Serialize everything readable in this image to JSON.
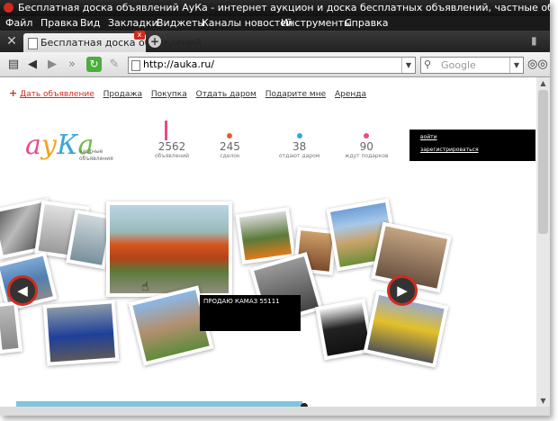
{
  "window": {
    "title": "Бесплатная доска объявлений АуКа - интернет аукцион и доска бесплатных объявлений, частные объявления - бесплат..."
  },
  "menu": [
    "Файл",
    "Правка",
    "Вид",
    "Закладки",
    "Виджеты",
    "Каналы новостей",
    "Инструменты",
    "Справка"
  ],
  "tab": {
    "label": "Бесплатная доска объявлений",
    "close_glyph": "x"
  },
  "address": {
    "url": "http://auka.ru/"
  },
  "search": {
    "placeholder": "Google"
  },
  "site": {
    "nav": [
      "Дать объявление",
      "Продажа",
      "Покупка",
      "Отдать даром",
      "Подарите мне",
      "Аренда"
    ],
    "logo": [
      "а",
      "у",
      "К",
      "а"
    ],
    "tagline": [
      "частные",
      "объявления"
    ],
    "stats": [
      {
        "value": "2562",
        "label": "объявлений",
        "color": "#e84b8a"
      },
      {
        "value": "245",
        "label": "сделок",
        "color": "#f2562f"
      },
      {
        "value": "38",
        "label": "отдают даром",
        "color": "#3aa6d9"
      },
      {
        "value": "90",
        "label": "ждут подарков",
        "color": "#e84b8a"
      }
    ],
    "login": {
      "enter": "войти",
      "register": "зарегистрироваться"
    },
    "tooltip": "ПРОДАЮ КАМАЗ 55111"
  },
  "icons": {
    "tools": "wrench-icon",
    "back": "arrow-left-icon",
    "forward": "arrow-right-icon",
    "reload": "reload-icon",
    "search": "magnifier-icon",
    "view": "glasses-icon",
    "trash": "trash-icon"
  }
}
